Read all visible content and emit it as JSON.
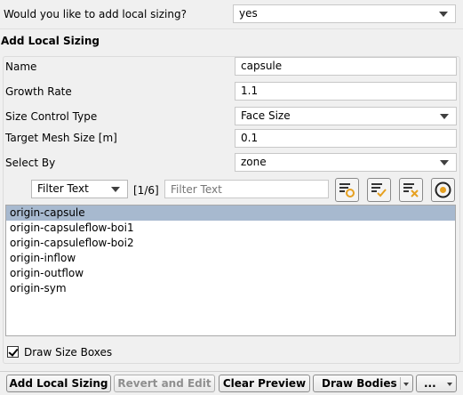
{
  "question": {
    "label": "Would you like to add local sizing?",
    "value": "yes"
  },
  "section": {
    "title": "Add Local Sizing"
  },
  "form": {
    "name_label": "Name",
    "name_value": "capsule",
    "growth_label": "Growth Rate",
    "growth_value": "1.1",
    "size_type_label": "Size Control Type",
    "size_type_value": "Face Size",
    "target_label": "Target Mesh Size [m]",
    "target_value": "0.1",
    "select_by_label": "Select By",
    "select_by_value": "zone"
  },
  "filter": {
    "mode": "Filter Text",
    "page": "[1/6]",
    "placeholder": "Filter Text"
  },
  "list": {
    "items": [
      "origin-capsule",
      "origin-capsuleflow-boi1",
      "origin-capsuleflow-boi2",
      "origin-inflow",
      "origin-outflow",
      "origin-sym"
    ],
    "selected_index": 0
  },
  "draw_boxes": {
    "label": "Draw Size Boxes",
    "checked": true
  },
  "buttons": {
    "add": "Add Local Sizing",
    "revert": "Revert and Edit",
    "clear": "Clear Preview",
    "draw": "Draw Bodies",
    "more": "..."
  },
  "icons": {
    "filter_options": "filter-options-icon",
    "select_all": "select-all-icon",
    "deselect_all": "deselect-all-icon",
    "pick": "pick-target-icon"
  },
  "colors": {
    "selection": "#a7b9cf",
    "accent_orange": "#e6a020"
  }
}
